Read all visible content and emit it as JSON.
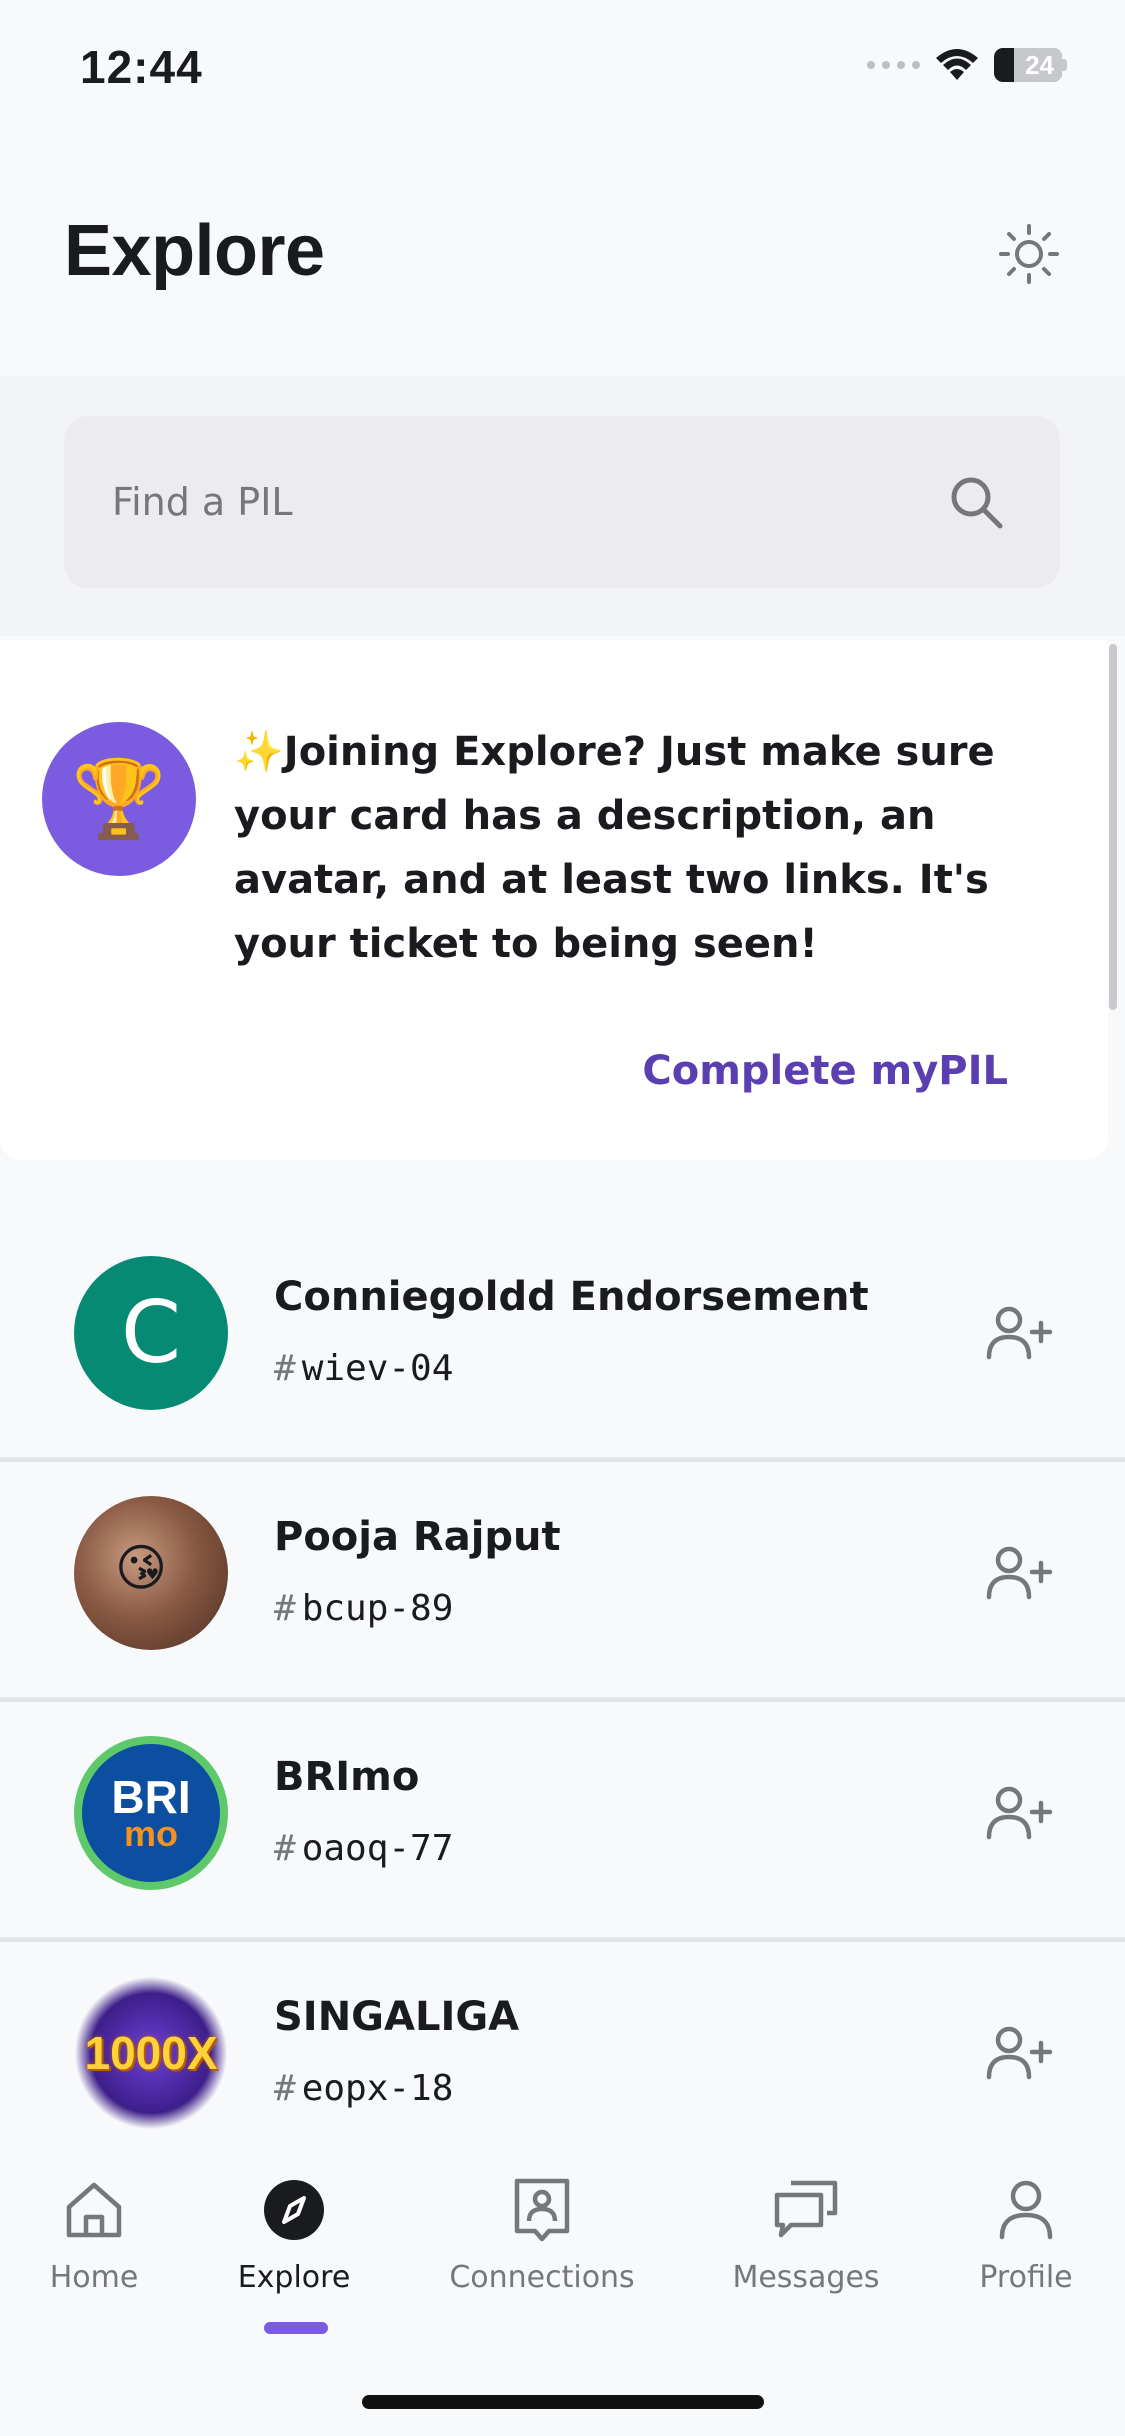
{
  "status_bar": {
    "time": "12:44",
    "battery": "24"
  },
  "header": {
    "title": "Explore"
  },
  "search": {
    "placeholder": "Find a PIL"
  },
  "banner": {
    "icon": "trophy",
    "text": "✨Joining Explore? Just make sure your card has a description, an avatar, and at least two links. It's your ticket to being seen!",
    "link": "Complete myPIL"
  },
  "profiles": [
    {
      "name": "Conniegoldd Endorsement",
      "hash": "#",
      "tag": "wiev-04",
      "avatar_initial": "C"
    },
    {
      "name": "Pooja Rajput",
      "hash": "#",
      "tag": "bcup-89",
      "avatar_emoji": "😘"
    },
    {
      "name": "BRImo",
      "hash": "#",
      "tag": "oaoq-77",
      "avatar_logo_top": "BRI",
      "avatar_logo_bottom": "mo"
    },
    {
      "name": "SINGALIGA",
      "hash": "#",
      "tag": "eopx-18",
      "avatar_logo": "1000X"
    }
  ],
  "tabs": [
    {
      "label": "Home",
      "icon": "home-icon"
    },
    {
      "label": "Explore",
      "icon": "compass-icon",
      "active": true
    },
    {
      "label": "Connections",
      "icon": "contact-card-icon"
    },
    {
      "label": "Messages",
      "icon": "chat-bubbles-icon"
    },
    {
      "label": "Profile",
      "icon": "person-icon"
    }
  ],
  "colors": {
    "accent": "#7b5be0",
    "link": "#5b3fb0",
    "avatar_green": "#078a74"
  }
}
